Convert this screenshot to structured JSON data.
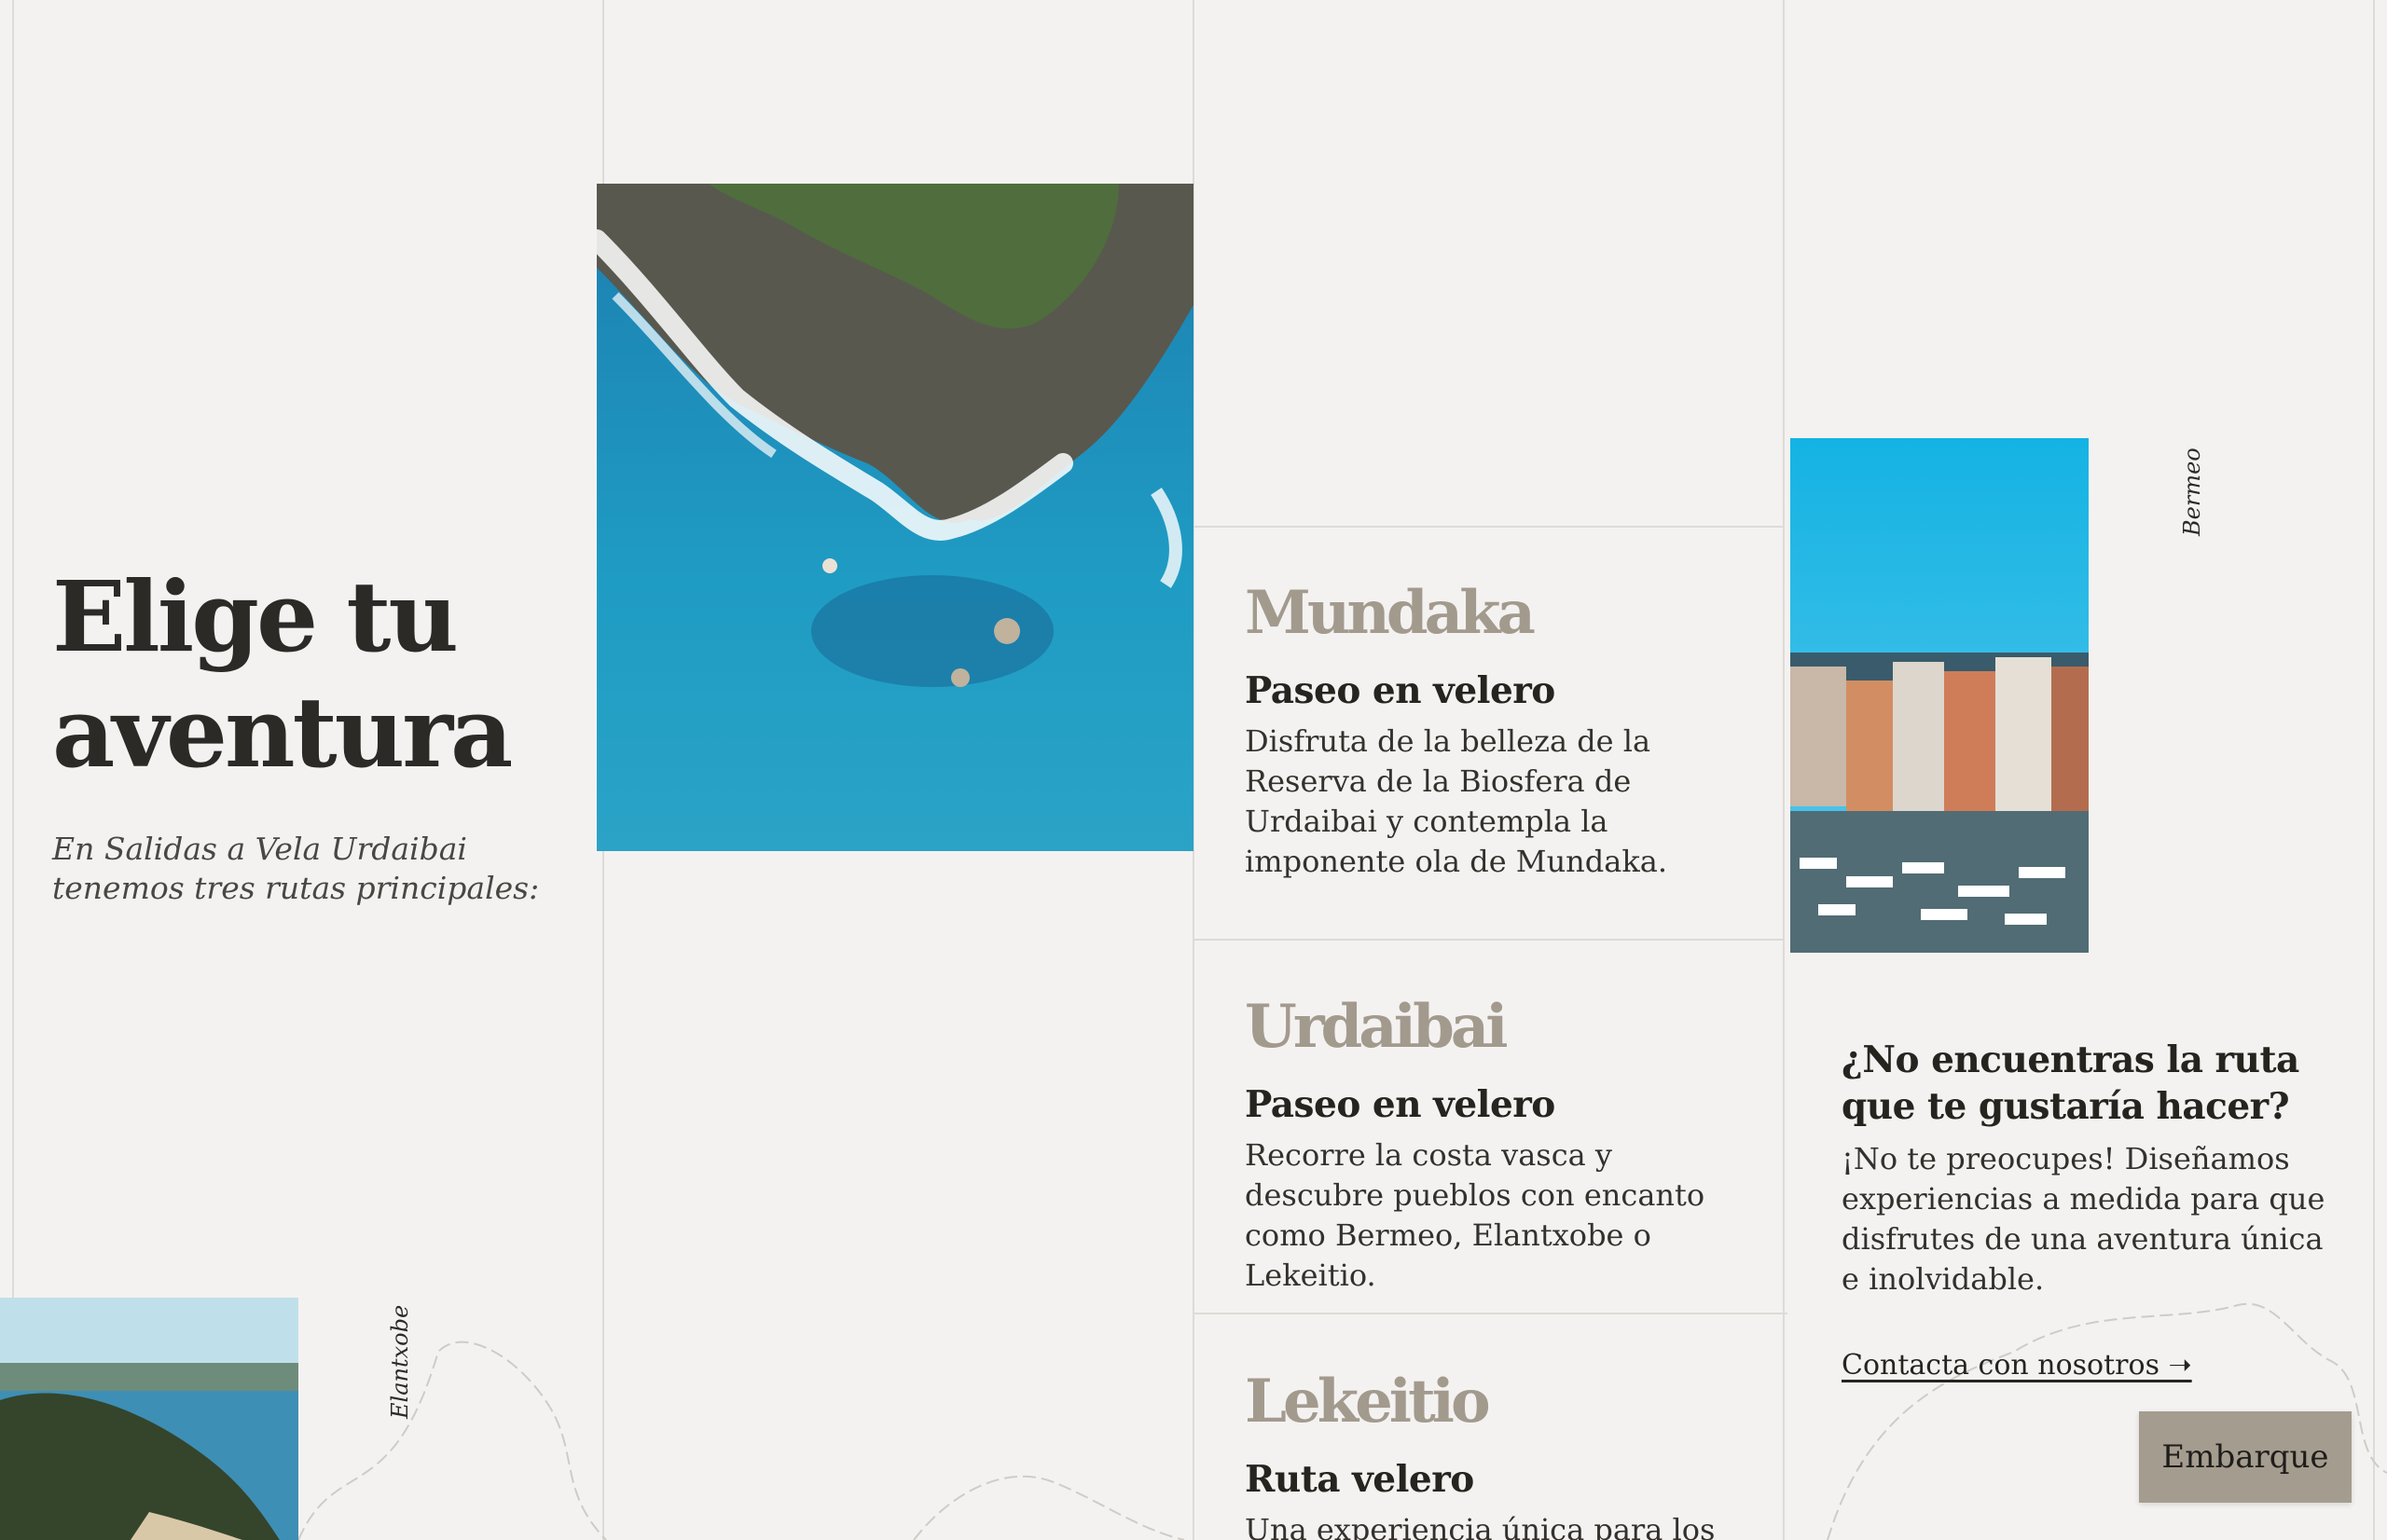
{
  "hero": {
    "title": "Elige tu aventura",
    "subtitle": "En Salidas a Vela Urdaibai tenemos tres rutas principales:"
  },
  "captions": {
    "bermeo": "Bermeo",
    "elantxobe": "Elantxobe"
  },
  "routes": [
    {
      "name": "Mundaka",
      "type": "Paseo en velero",
      "description": "Disfruta de la belleza de la Reserva de la Biosfera de Urdaibai y contempla la imponente ola de Mundaka."
    },
    {
      "name": "Urdaibai",
      "type": "Paseo en velero",
      "description": "Recorre la costa vasca y descubre pueblos con encanto como Bermeo, Elantxobe o Lekeitio."
    },
    {
      "name": "Lekeitio",
      "type": "Ruta velero",
      "description": "Una experiencia única para los"
    }
  ],
  "cta": {
    "title": "¿No encuentras la ruta que te gustaría hacer?",
    "description": "¡No te preocupes! Diseñamos experiencias a medida para que disfrutes de una aventura única e inolvidable.",
    "link_label": "Contacta con nosotros ➝"
  },
  "embarque_button": "Embarque",
  "colors": {
    "background": "#f4f2f1",
    "route_name": "#a39a8e",
    "button": "#a49c8f",
    "text": "#2c2a27"
  }
}
